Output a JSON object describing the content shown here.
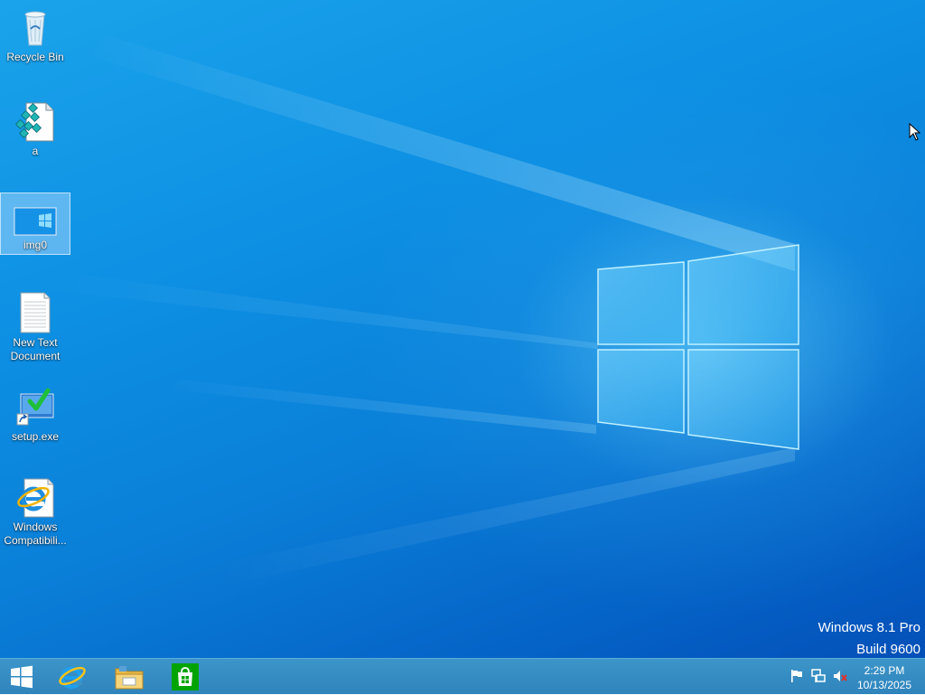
{
  "desktop": {
    "icons": [
      {
        "label": "Recycle Bin",
        "icon": "recycle-bin-icon"
      },
      {
        "label": "a",
        "icon": "registry-file-icon"
      },
      {
        "label": "img0",
        "icon": "image-file-icon",
        "selected": true
      },
      {
        "label": "New Text Document",
        "icon": "text-document-icon"
      },
      {
        "label": "setup.exe",
        "icon": "setup-exe-icon"
      },
      {
        "label": "Windows Compatibili...",
        "icon": "internet-explorer-shortcut-icon"
      }
    ]
  },
  "watermark": {
    "edition": "Windows 8.1 Pro",
    "build": "Build 9600"
  },
  "taskbar": {
    "buttons": [
      {
        "name": "start",
        "icon": "windows-start-icon"
      },
      {
        "name": "internet-explorer",
        "icon": "internet-explorer-icon"
      },
      {
        "name": "file-explorer",
        "icon": "file-explorer-icon"
      },
      {
        "name": "store",
        "icon": "store-icon"
      }
    ],
    "tray": {
      "icons": [
        "action-center-flag-icon",
        "network-icon",
        "volume-muted-icon"
      ],
      "time": "2:29 PM",
      "date": "10/13/2025"
    }
  },
  "colors": {
    "desktop_blue": "#0d8fe3",
    "taskbar_blue": "#3c95c9",
    "store_green": "#00a300"
  }
}
